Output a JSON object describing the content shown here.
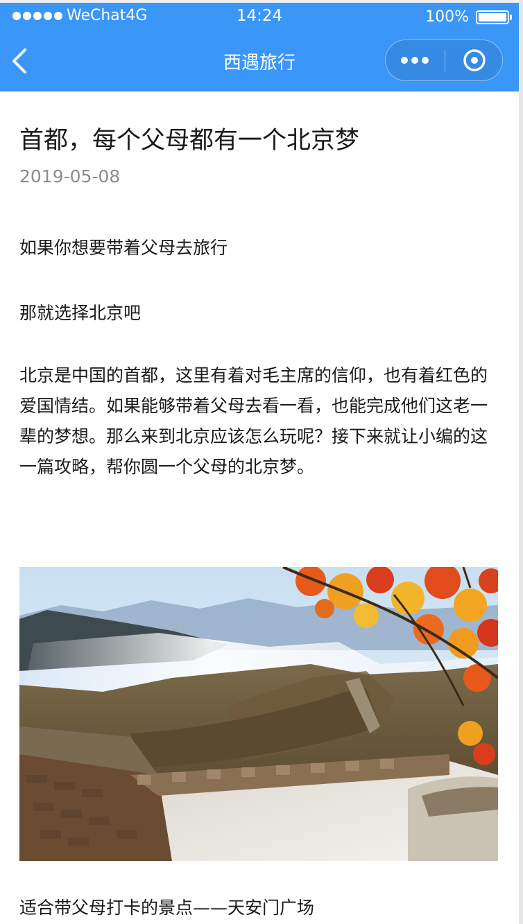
{
  "status_bar": {
    "carrier": "WeChat4G",
    "time": "14:24",
    "battery": "100%"
  },
  "nav": {
    "title": "西遇旅行"
  },
  "article": {
    "title": "首都，每个父母都有一个北京梦",
    "date": "2019-05-08",
    "paragraphs": [
      "如果你想要带着父母去旅行",
      "那就选择北京吧",
      "北京是中国的首都，这里有着对毛主席的信仰，也有着红色的爱国情结。如果能够带着父母去看一看，也能完成他们这老一辈的梦想。那么来到北京应该怎么玩呢？接下来就让小编的这一篇攻略，帮你圆一个父母的北京梦。"
    ],
    "section_heading": "适合带父母打卡的景点——天安门广场"
  },
  "colors": {
    "header_bg": "#3a96f7",
    "text": "#1a1a1a",
    "date_text": "#8c8c8c"
  },
  "icons": {
    "back": "chevron-left-icon",
    "more": "more-dots-icon",
    "close": "target-circle-icon",
    "battery": "battery-icon",
    "signal": "signal-dots-icon"
  }
}
